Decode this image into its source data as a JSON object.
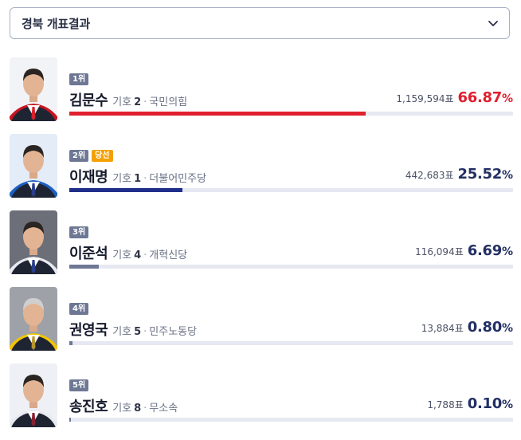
{
  "dropdown": {
    "label": "경북 개표결과",
    "icon": "chevron-down-icon"
  },
  "labels": {
    "number_prefix": "기호",
    "votes_suffix": "표",
    "separator": "·",
    "percent_sign": "%"
  },
  "candidates": [
    {
      "rank": "1위",
      "winner_badge": null,
      "name": "김문수",
      "number": "2",
      "party": "국민의힘",
      "votes": "1,159,594",
      "percent": "66.87",
      "share": 0.6687,
      "color": "#e0202f",
      "text_color": "#e0202f",
      "bg": "#f2f3f6",
      "tie": "#d9202c",
      "sash": "#c8141f"
    },
    {
      "rank": "2위",
      "winner_badge": "당선",
      "name": "이재명",
      "number": "1",
      "party": "더불어민주당",
      "votes": "442,683",
      "percent": "25.52",
      "share": 0.2552,
      "color": "#1f2f8a",
      "text_color": "#233064",
      "bg": "#e3ecf7",
      "tie": "#2a3e8c",
      "sash": "#1c5fc0"
    },
    {
      "rank": "3위",
      "winner_badge": null,
      "name": "이준석",
      "number": "4",
      "party": "개혁신당",
      "votes": "116,094",
      "percent": "6.69",
      "share": 0.0669,
      "color": "#6e7894",
      "text_color": "#233064",
      "bg": "#6c6f78",
      "tie": "#2a3e8c",
      "sash": "#e8eaf0"
    },
    {
      "rank": "4위",
      "winner_badge": null,
      "name": "권영국",
      "number": "5",
      "party": "민주노동당",
      "votes": "13,884",
      "percent": "0.80",
      "share": 0.008,
      "color": "#6e7894",
      "text_color": "#233064",
      "bg": "#9ea2a8",
      "tie": "#b8962e",
      "sash": "#f2c400"
    },
    {
      "rank": "5위",
      "winner_badge": null,
      "name": "송진호",
      "number": "8",
      "party": "무소속",
      "votes": "1,788",
      "percent": "0.10",
      "share": 0.001,
      "color": "#6e7894",
      "text_color": "#233064",
      "bg": "#eef0f5",
      "tie": "#8a2030",
      "sash": "#e8eaf0"
    }
  ]
}
